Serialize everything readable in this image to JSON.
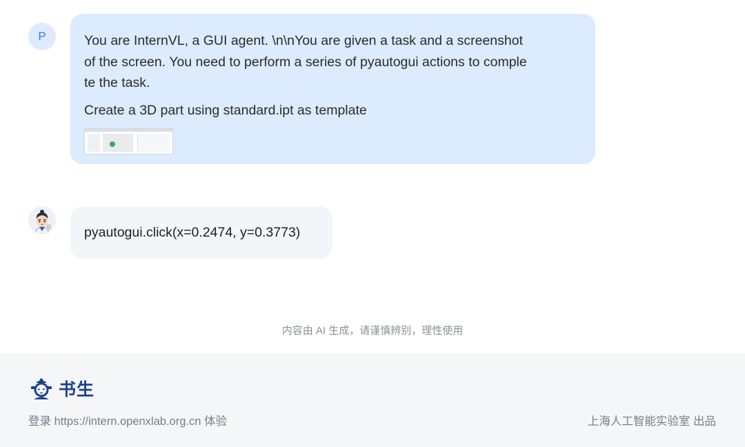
{
  "user": {
    "avatar_letter": "P",
    "message_lines": [
      "You are InternVL, a GUI agent. \\n\\nYou are given a task and a screenshot",
      "of the screen. You need to perform a series of pyautogui actions to comple",
      "te the task."
    ],
    "task": "Create a 3D part using standard.ipt as template",
    "attachment_icon": "screenshot-thumbnail"
  },
  "assistant": {
    "avatar_icon": "scholar-mascot-avatar",
    "response": "pyautogui.click(x=0.2474, y=0.3773)"
  },
  "disclaimer": "内容由 AI 生成，请谨慎辨别，理性使用",
  "footer": {
    "brand_name": "书生",
    "login_text": "登录 https://intern.openxlab.org.cn 体验",
    "credit_text": "上海人工智能实验室 出品"
  },
  "colors": {
    "user_bubble": "#dcebfe",
    "assistant_bubble": "#f4f5f8",
    "brand": "#1d3f8f",
    "footer_bg": "#f5f6f8"
  }
}
